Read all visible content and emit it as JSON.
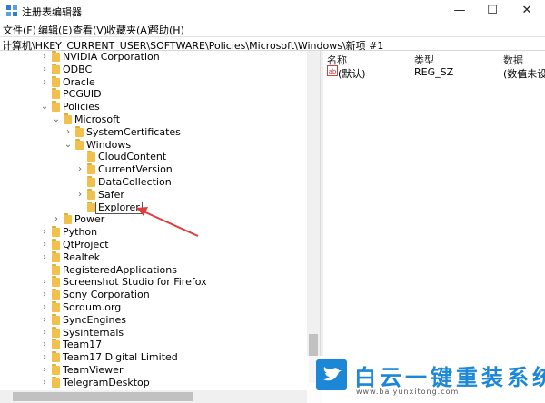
{
  "window": {
    "title": "注册表编辑器",
    "controls": {
      "minimize": "—",
      "maximize": "☐",
      "close": "✕"
    }
  },
  "menu": [
    "文件(F)",
    "编辑(E)",
    "查看(V)",
    "收藏夹(A)",
    "帮助(H)"
  ],
  "address": "计算机\\HKEY_CURRENT_USER\\SOFTWARE\\Policies\\Microsoft\\Windows\\新项 #1",
  "tree": [
    {
      "label": "NVIDIA Corporation",
      "chevron": "›",
      "depth": 0
    },
    {
      "label": "ODBC",
      "chevron": "›",
      "depth": 0
    },
    {
      "label": "Oracle",
      "chevron": "›",
      "depth": 0
    },
    {
      "label": "PCGUID",
      "chevron": "",
      "depth": 0
    },
    {
      "label": "Policies",
      "chevron": "⌄",
      "depth": 0
    },
    {
      "label": "Microsoft",
      "chevron": "⌄",
      "depth": 1
    },
    {
      "label": "SystemCertificates",
      "chevron": "›",
      "depth": 2
    },
    {
      "label": "Windows",
      "chevron": "⌄",
      "depth": 2
    },
    {
      "label": "CloudContent",
      "chevron": "",
      "depth": 3
    },
    {
      "label": "CurrentVersion",
      "chevron": "›",
      "depth": 3
    },
    {
      "label": "DataCollection",
      "chevron": "",
      "depth": 3
    },
    {
      "label": "Safer",
      "chevron": "›",
      "depth": 3
    },
    {
      "label": "Explorer",
      "chevron": "",
      "depth": 3,
      "editing": true
    },
    {
      "label": "Power",
      "chevron": "›",
      "depth": 1
    },
    {
      "label": "Python",
      "chevron": "›",
      "depth": 0
    },
    {
      "label": "QtProject",
      "chevron": "›",
      "depth": 0
    },
    {
      "label": "Realtek",
      "chevron": "›",
      "depth": 0
    },
    {
      "label": "RegisteredApplications",
      "chevron": "",
      "depth": 0
    },
    {
      "label": "Screenshot Studio for Firefox",
      "chevron": "›",
      "depth": 0
    },
    {
      "label": "Sony Corporation",
      "chevron": "›",
      "depth": 0
    },
    {
      "label": "Sordum.org",
      "chevron": "›",
      "depth": 0
    },
    {
      "label": "SyncEngines",
      "chevron": "›",
      "depth": 0
    },
    {
      "label": "Sysinternals",
      "chevron": "›",
      "depth": 0
    },
    {
      "label": "Team17",
      "chevron": "›",
      "depth": 0
    },
    {
      "label": "Team17 Digital Limited",
      "chevron": "›",
      "depth": 0
    },
    {
      "label": "TeamViewer",
      "chevron": "›",
      "depth": 0
    },
    {
      "label": "TelegramDesktop",
      "chevron": "›",
      "depth": 0
    }
  ],
  "values_pane": {
    "headers": {
      "name": "名称",
      "type": "类型",
      "data": "数据"
    },
    "rows": [
      {
        "icon": "ab",
        "name": "(默认)",
        "type": "REG_SZ",
        "data": "(数值未设置)"
      }
    ]
  },
  "colors": {
    "folder": "#f2c14b",
    "arrow": "#e03c3c",
    "watermark": "#1b87d6"
  },
  "watermark": {
    "text": "白云一键重装系统",
    "url": "www.baiyunxitong.com"
  }
}
